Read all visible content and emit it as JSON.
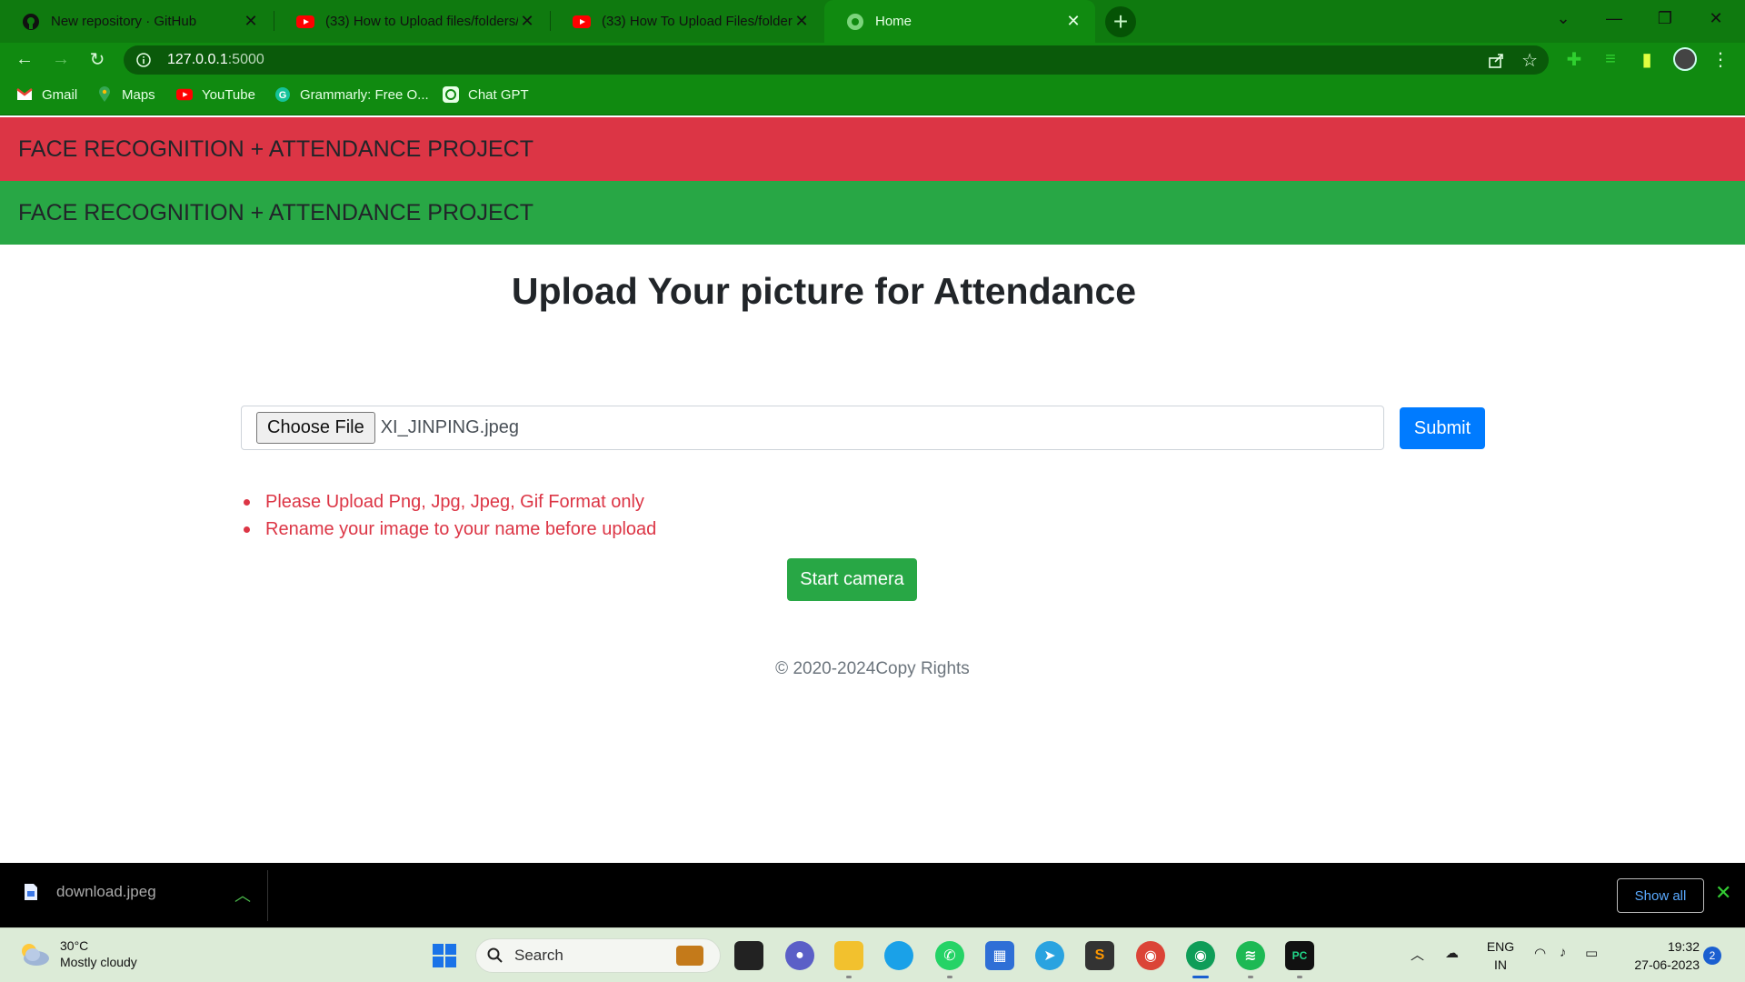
{
  "browser": {
    "tabs": [
      {
        "title": "New repository · GitHub",
        "icon": "github-icon"
      },
      {
        "title": "(33) How to Upload files/folders/",
        "icon": "youtube-icon"
      },
      {
        "title": "(33) How To Upload Files/folders",
        "icon": "youtube-icon"
      },
      {
        "title": "Home",
        "icon": "globe-icon",
        "active": true
      }
    ],
    "url_host": "127.0.0.1",
    "url_port": ":5000",
    "bookmarks": [
      {
        "label": "Gmail",
        "icon": "gmail-icon"
      },
      {
        "label": "Maps",
        "icon": "maps-icon"
      },
      {
        "label": "YouTube",
        "icon": "youtube-icon"
      },
      {
        "label": "Grammarly: Free O...",
        "icon": "grammarly-icon"
      },
      {
        "label": "Chat GPT",
        "icon": "chatgpt-icon"
      }
    ],
    "accent": "#108a10"
  },
  "page": {
    "nav_red_brand": "FACE RECOGNITION + ATTENDANCE PROJECT",
    "nav_green_brand": "FACE RECOGNITION + ATTENDANCE PROJECT",
    "heading": "Upload Your picture for Attendance",
    "choose_file_label": "Choose File",
    "file_name": "XI_JINPING.jpeg",
    "submit_label": "Submit",
    "rules": [
      "Please Upload Png, Jpg, Jpeg, Gif Format only",
      "Rename your image to your name before upload"
    ],
    "camera_label": "Start camera",
    "footer": "© 2020-2024Copy Rights",
    "colors": {
      "danger": "#dc3545",
      "success": "#28a745",
      "primary": "#007bff"
    }
  },
  "download_bar": {
    "file": "download.jpeg",
    "show_all": "Show all"
  },
  "taskbar": {
    "weather_temp": "30°C",
    "weather_desc": "Mostly cloudy",
    "search_placeholder": "Search",
    "lang_line1": "ENG",
    "lang_line2": "IN",
    "time": "19:32",
    "date": "27-06-2023",
    "notifications": "2"
  }
}
